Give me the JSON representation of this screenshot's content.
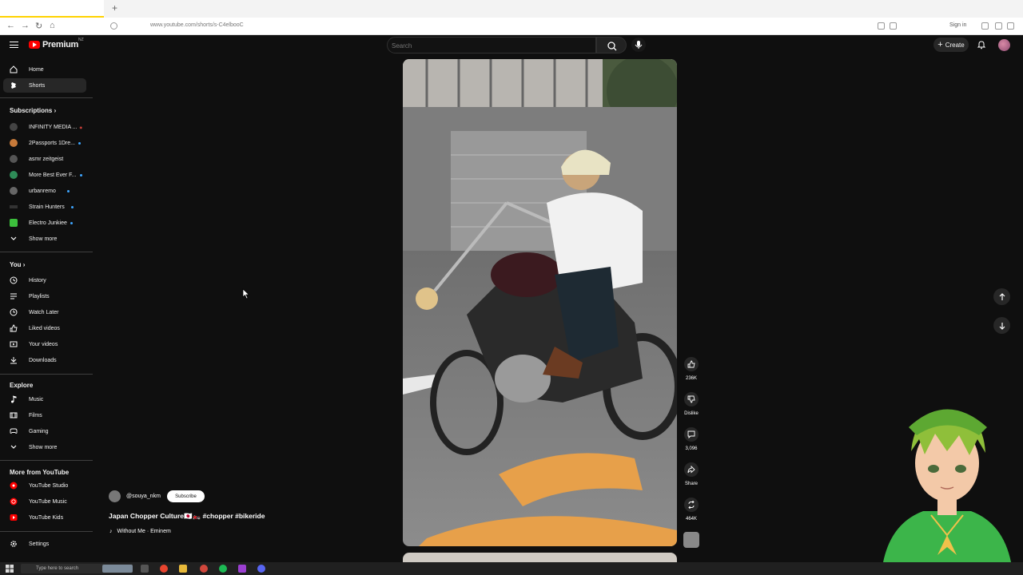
{
  "browser": {
    "url": "www.youtube.com/shorts/s-C4elbooC",
    "sign_in": "Sign in"
  },
  "header": {
    "logo_text": "Premium",
    "logo_region": "NZ",
    "search_placeholder": "Search",
    "create_label": "Create"
  },
  "sidebar": {
    "main": [
      {
        "label": "Home",
        "icon": "home-icon"
      },
      {
        "label": "Shorts",
        "icon": "shorts-icon",
        "active": true
      }
    ],
    "subscriptions_heading": "Subscriptions",
    "subscriptions": [
      {
        "label": "INFINITY MEDIA ...",
        "badge": "live",
        "color": "#444444"
      },
      {
        "label": "2Passports 1Dre...",
        "badge": "dot",
        "color": "#c77a3a"
      },
      {
        "label": "asmr zeitgeist",
        "badge": "",
        "color": "#555555"
      },
      {
        "label": "More Best Ever F...",
        "badge": "dot",
        "color": "#2e8b57"
      },
      {
        "label": "urbanremo",
        "badge": "dot",
        "color": "#666666"
      },
      {
        "label": "Strain Hunters",
        "badge": "dot",
        "color": "#333333"
      },
      {
        "label": "Electro Junkiee",
        "badge": "dot",
        "color": "#3cbf3c"
      }
    ],
    "show_more_1": "Show more",
    "you_heading": "You",
    "you": [
      {
        "label": "History",
        "icon": "history-icon"
      },
      {
        "label": "Playlists",
        "icon": "playlists-icon"
      },
      {
        "label": "Watch Later",
        "icon": "watch-later-icon"
      },
      {
        "label": "Liked videos",
        "icon": "liked-videos-icon"
      },
      {
        "label": "Your videos",
        "icon": "your-videos-icon"
      },
      {
        "label": "Downloads",
        "icon": "downloads-icon"
      }
    ],
    "explore_heading": "Explore",
    "explore": [
      {
        "label": "Music",
        "icon": "music-icon"
      },
      {
        "label": "Films",
        "icon": "films-icon"
      },
      {
        "label": "Gaming",
        "icon": "gaming-icon"
      }
    ],
    "show_more_2": "Show more",
    "more_heading": "More from YouTube",
    "more": [
      {
        "label": "YouTube Studio",
        "icon": "youtube-studio-icon"
      },
      {
        "label": "YouTube Music",
        "icon": "youtube-music-icon"
      },
      {
        "label": "YouTube Kids",
        "icon": "youtube-kids-icon"
      }
    ],
    "settings_label": "Settings"
  },
  "short": {
    "channel": "@souya_nkm",
    "subscribe_label": "Subscribe",
    "title": "Japan Chopper Culture🇯🇵🏍️ #chopper #bikeride",
    "music": "Without Me · Eminem",
    "likes": "236K",
    "dislike_label": "Dislike",
    "comments": "3,096",
    "share_label": "Share",
    "remix_count": "464K"
  },
  "taskbar": {
    "search_placeholder": "Type here to search"
  }
}
